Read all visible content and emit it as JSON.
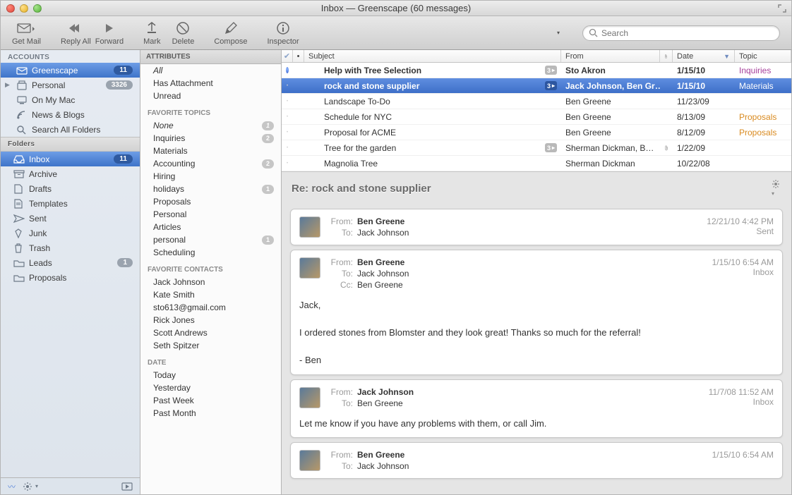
{
  "window": {
    "title": "Inbox — Greenscape (60 messages)"
  },
  "toolbar": {
    "getmail": "Get Mail",
    "replyall": "Reply All",
    "forward": "Forward",
    "mark": "Mark",
    "delete": "Delete",
    "compose": "Compose",
    "inspector": "Inspector",
    "search_placeholder": "Search"
  },
  "sidebar": {
    "accounts_hdr": "ACCOUNTS",
    "accounts": [
      {
        "name": "Greenscape",
        "badge": "11",
        "selected": true
      },
      {
        "name": "Personal",
        "badge": "3326",
        "disclosure": true
      },
      {
        "name": "On My Mac"
      },
      {
        "name": "News & Blogs"
      },
      {
        "name": "Search All Folders"
      }
    ],
    "folders_hdr": "Folders",
    "folders": [
      {
        "name": "Inbox",
        "badge": "11",
        "selected": true
      },
      {
        "name": "Archive"
      },
      {
        "name": "Drafts"
      },
      {
        "name": "Templates"
      },
      {
        "name": "Sent"
      },
      {
        "name": "Junk"
      },
      {
        "name": "Trash"
      },
      {
        "name": "Leads",
        "badge": "1"
      },
      {
        "name": "Proposals"
      }
    ]
  },
  "pane2": {
    "attributes_hdr": "ATTRIBUTES",
    "attributes": [
      {
        "label": "All",
        "ital": true
      },
      {
        "label": "Has Attachment"
      },
      {
        "label": "Unread"
      }
    ],
    "favtopics_hdr": "FAVORITE TOPICS",
    "favtopics": [
      {
        "label": "None",
        "count": "1",
        "ital": true
      },
      {
        "label": "Inquiries",
        "count": "2"
      },
      {
        "label": "Materials"
      },
      {
        "label": "Accounting",
        "count": "2"
      },
      {
        "label": "Hiring"
      },
      {
        "label": "holidays",
        "count": "1"
      },
      {
        "label": "Proposals"
      },
      {
        "label": "Personal"
      },
      {
        "label": "Articles"
      },
      {
        "label": "personal",
        "count": "1"
      },
      {
        "label": "Scheduling"
      }
    ],
    "favcontacts_hdr": "FAVORITE CONTACTS",
    "favcontacts": [
      "Jack Johnson",
      "Kate Smith",
      "sto613@gmail.com",
      "Rick Jones",
      "Scott Andrews",
      "Seth Spitzer"
    ],
    "date_hdr": "DATE",
    "dates": [
      "Today",
      "Yesterday",
      "Past Week",
      "Past Month"
    ]
  },
  "list": {
    "cols": {
      "subject": "Subject",
      "from": "From",
      "date": "Date",
      "topic": "Topic"
    },
    "rows": [
      {
        "unread": true,
        "bold": true,
        "subject": "Help with Tree Selection",
        "count": "3",
        "from": "Sto Akron",
        "date": "1/15/10",
        "topic": "Inquiries",
        "topic_cls": "topic-inq"
      },
      {
        "selected": true,
        "bold": true,
        "subject": "rock and stone supplier",
        "count": "3",
        "from": "Jack Johnson, Ben Gr…",
        "date": "1/15/10",
        "topic": "Materials",
        "topic_cls": "topic-mat"
      },
      {
        "subject": "Landscape To-Do",
        "from": "Ben Greene",
        "date": "11/23/09"
      },
      {
        "subject": "Schedule for NYC",
        "from": "Ben Greene",
        "date": "8/13/09",
        "topic": "Proposals",
        "topic_cls": "topic-prop"
      },
      {
        "subject": "Proposal for ACME",
        "from": "Ben Greene",
        "date": "8/12/09",
        "topic": "Proposals",
        "topic_cls": "topic-prop"
      },
      {
        "subject": "Tree for the garden",
        "count": "3",
        "from": "Sherman Dickman, B…",
        "attach": true,
        "date": "1/22/09"
      },
      {
        "subject": "Magnolia Tree",
        "from": "Sherman Dickman",
        "date": "10/22/08"
      }
    ]
  },
  "thread": {
    "subject": "Re: rock and stone supplier",
    "cards": [
      {
        "from": "Ben Greene",
        "to": "Jack Johnson",
        "ts": "12/21/10 4:42 PM",
        "loc": "Sent"
      },
      {
        "from": "Ben Greene",
        "to": "Jack Johnson",
        "cc": "Ben Greene",
        "ts": "1/15/10 6:54 AM",
        "loc": "Inbox",
        "body": "Jack,\n\nI ordered stones from Blomster and they look great!  Thanks so much for the referral!\n\n- Ben"
      },
      {
        "from": "Jack Johnson",
        "to": "Ben Greene",
        "ts": "11/7/08 11:52 AM",
        "loc": "Inbox",
        "body": "Let me know if you have any problems with them, or call Jim."
      },
      {
        "from": "Ben Greene",
        "to": "Jack Johnson",
        "ts": "1/15/10 6:54 AM",
        "loc": ""
      }
    ]
  }
}
